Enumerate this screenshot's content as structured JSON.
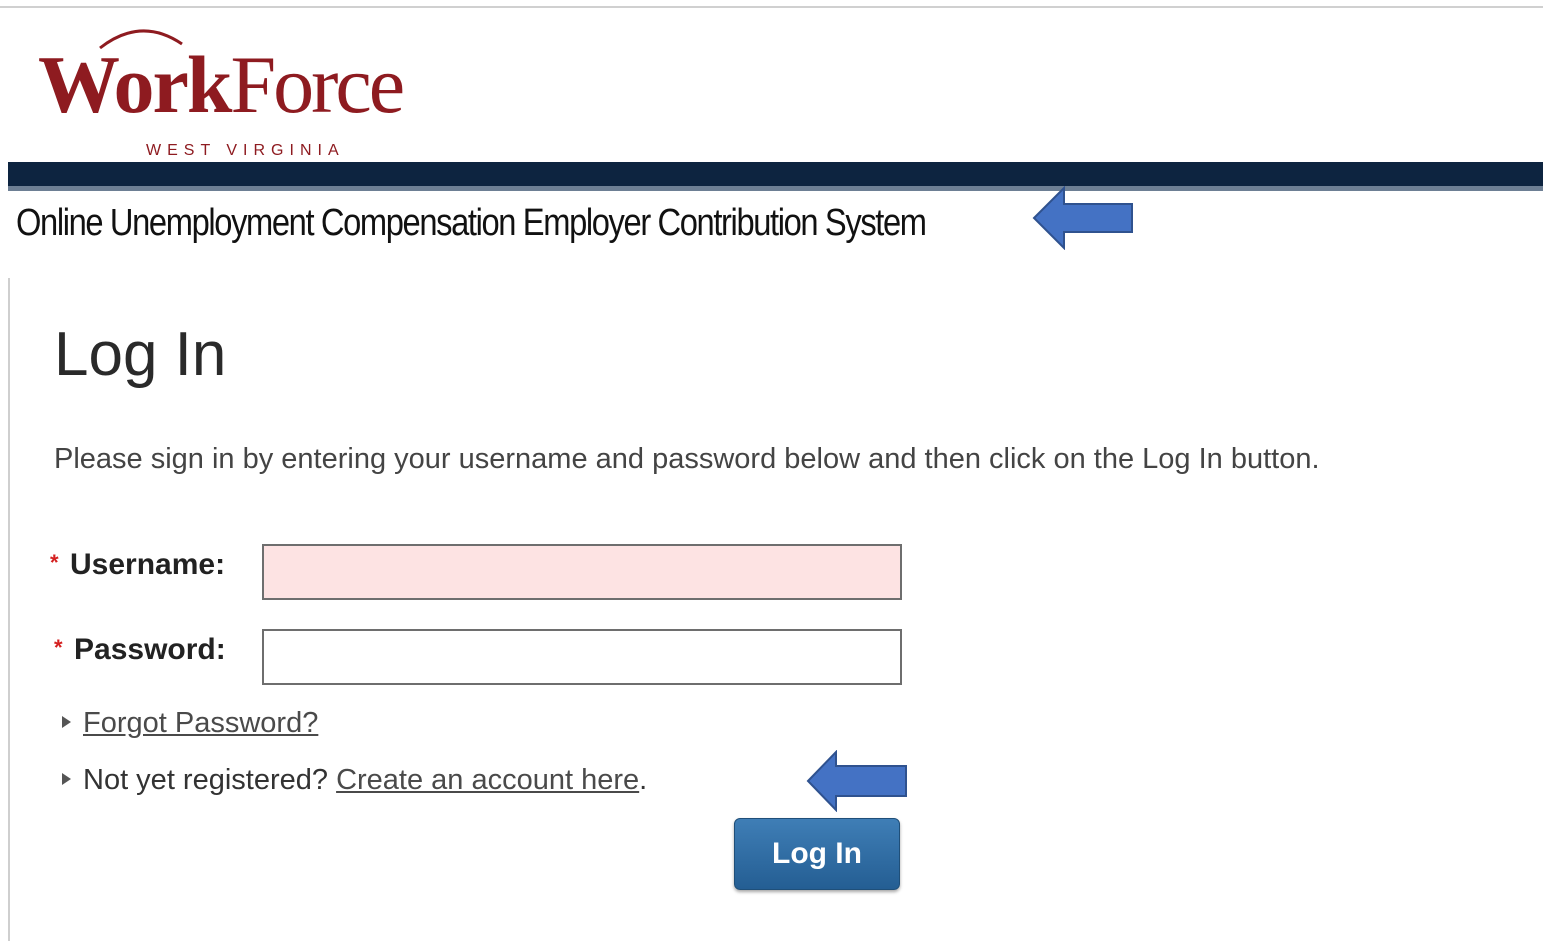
{
  "branding": {
    "logo_word_bold": "Work",
    "logo_word_regular": "Force",
    "logo_subtitle": "WEST VIRGINIA",
    "brand_color": "#8e1b20",
    "banner_color": "#0d2440"
  },
  "header": {
    "system_title": "Online Unemployment Compensation Employer Contribution System"
  },
  "login": {
    "heading": "Log In",
    "instructions": "Please sign in by entering your username and password below and then click on the Log In button.",
    "required_marker": "*",
    "username_label": "Username:",
    "username_value": "",
    "password_label": "Password:",
    "password_value": "",
    "forgot_password_link": "Forgot Password?",
    "register_prompt": "Not yet registered?",
    "register_link": "Create an account here",
    "register_suffix": ".",
    "submit_label": "Log In"
  },
  "annotations": {
    "arrow_color": "#4472c4",
    "arrow_icon": "left-arrow-icon"
  }
}
